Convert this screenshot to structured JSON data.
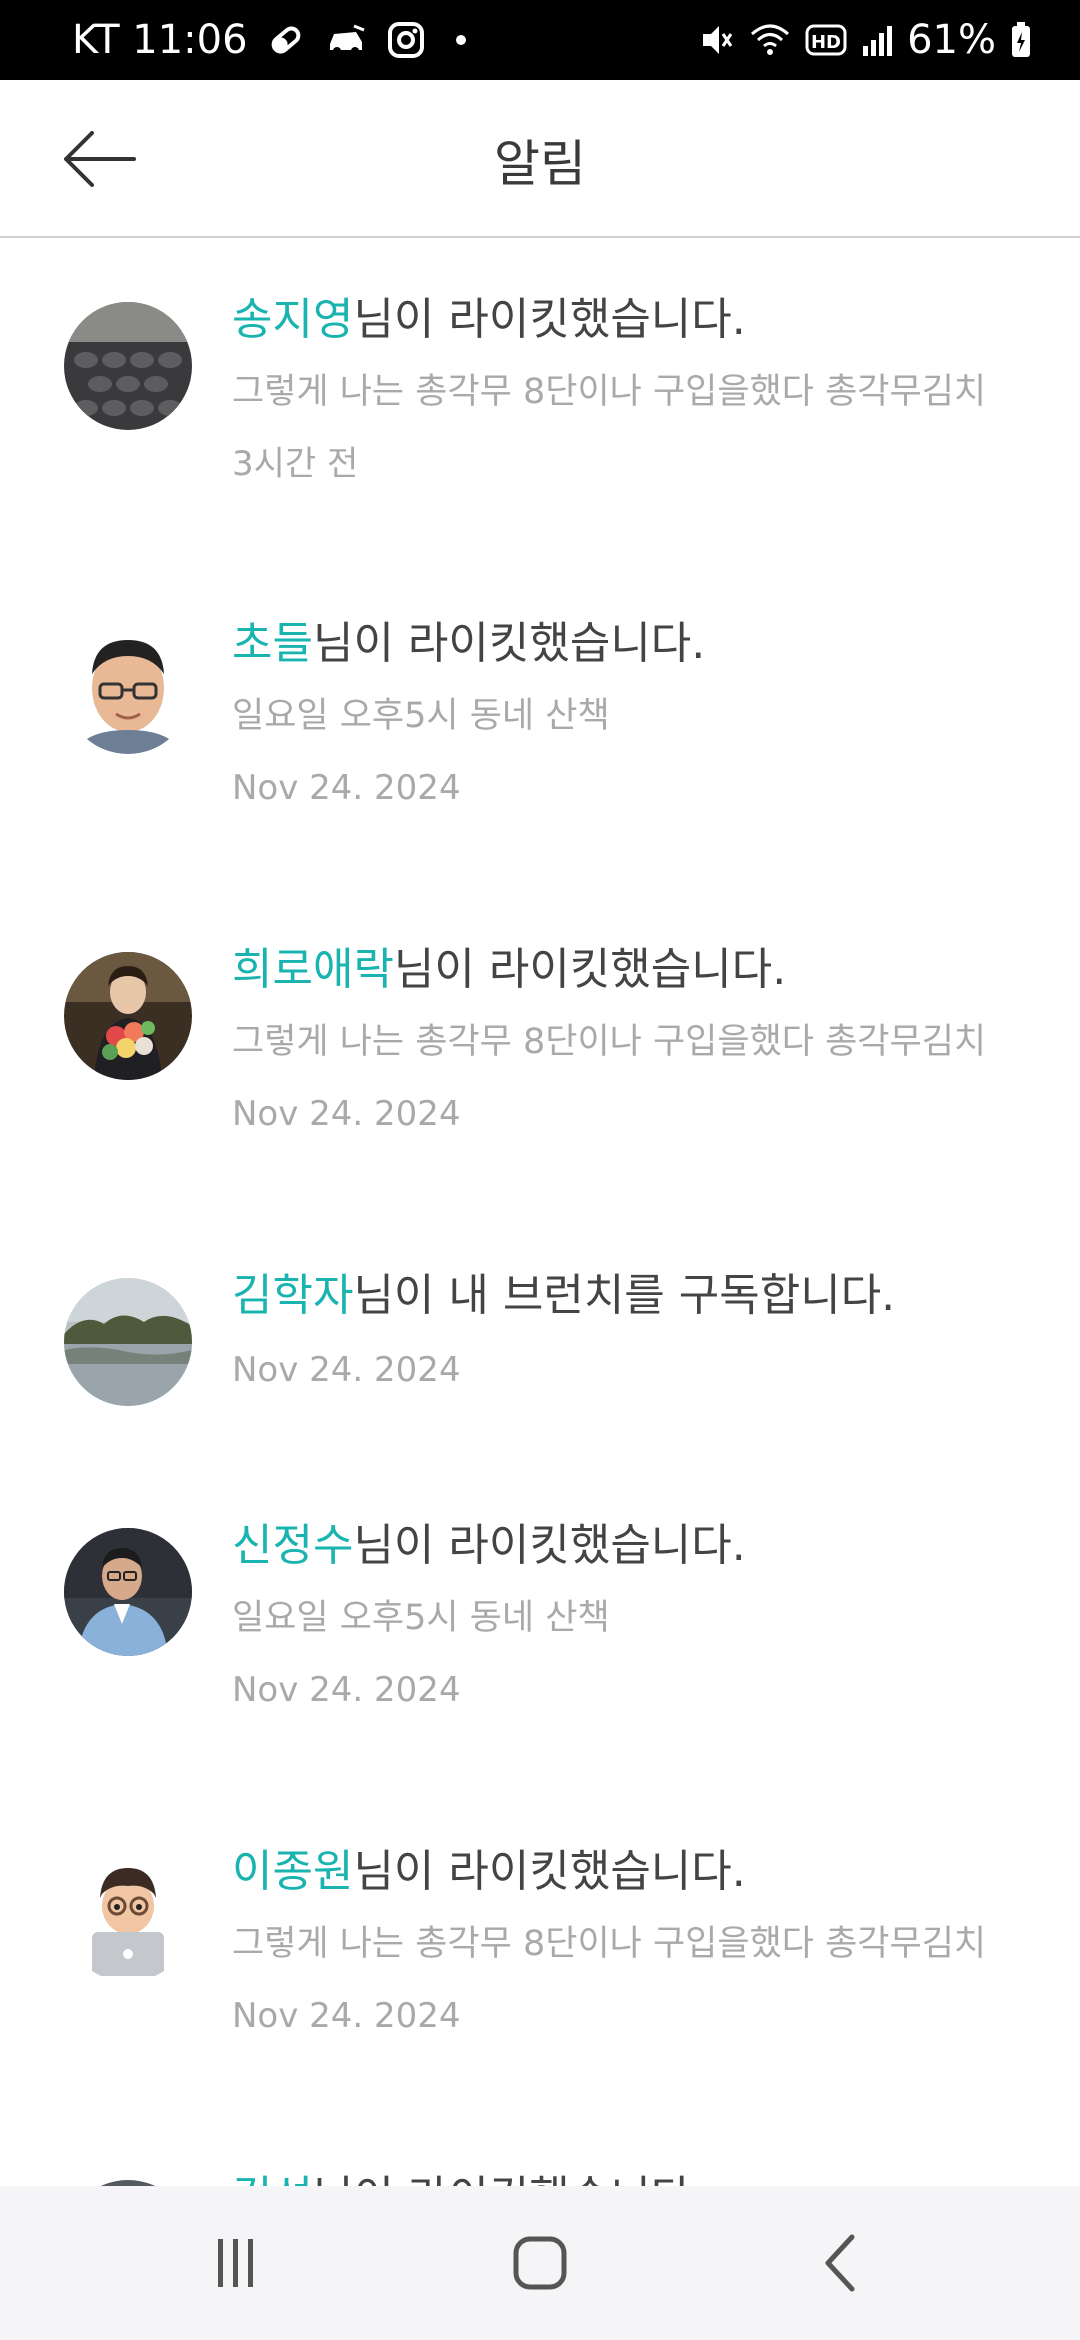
{
  "status_bar": {
    "carrier_time": "KT 11:06",
    "battery": "61%",
    "icons_left": [
      "pill-icon",
      "car-icon",
      "instagram-icon",
      "dot-icon"
    ],
    "icons_right": [
      "mute-icon",
      "wifi-icon",
      "hd-icon",
      "signal-icon",
      "battery-charging-icon"
    ]
  },
  "header": {
    "title": "알림",
    "back_icon": "back-arrow-icon"
  },
  "notifications": [
    {
      "name": "송지영",
      "action": "님이 라이킷했습니다.",
      "snippet": "그렇게 나는 총각무 8단이나 구입을했다 총각무김치",
      "time": "3시간 전",
      "avatar": "keyboard-photo"
    },
    {
      "name": "초들",
      "action": "님이 라이킷했습니다.",
      "snippet": "일요일 오후5시 동네 산책",
      "time": "Nov 24. 2024",
      "avatar": "man-glasses-photo"
    },
    {
      "name": "희로애락",
      "action": "님이 라이킷했습니다.",
      "snippet": "그렇게 나는 총각무 8단이나 구입을했다 총각무김치",
      "time": "Nov 24. 2024",
      "avatar": "person-flowers-photo"
    },
    {
      "name": "김학자",
      "action": "님이 내 브런치를 구독합니다.",
      "snippet": "",
      "time": "Nov 24. 2024",
      "avatar": "lake-photo"
    },
    {
      "name": "신정수",
      "action": "님이 라이킷했습니다.",
      "snippet": "일요일 오후5시 동네 산책",
      "time": "Nov 24. 2024",
      "avatar": "man-office-photo"
    },
    {
      "name": "이종원",
      "action": "님이 라이킷했습니다.",
      "snippet": "그렇게 나는 총각무 8단이나 구입을했다 총각무김치",
      "time": "Nov 24. 2024",
      "avatar": "memoji-laptop"
    },
    {
      "name": "김성",
      "action": "님이 라이킷했습니다.",
      "snippet": "",
      "time": "",
      "avatar": "partial-photo"
    }
  ],
  "nav_bar": {
    "recents": "recents-icon",
    "home": "home-icon",
    "back": "back-icon"
  },
  "colors": {
    "accent": "#19b3b0",
    "text": "#444444",
    "muted": "#a9a9a9",
    "status_bar": "#000000",
    "nav_bar": "#f5f5f7"
  }
}
